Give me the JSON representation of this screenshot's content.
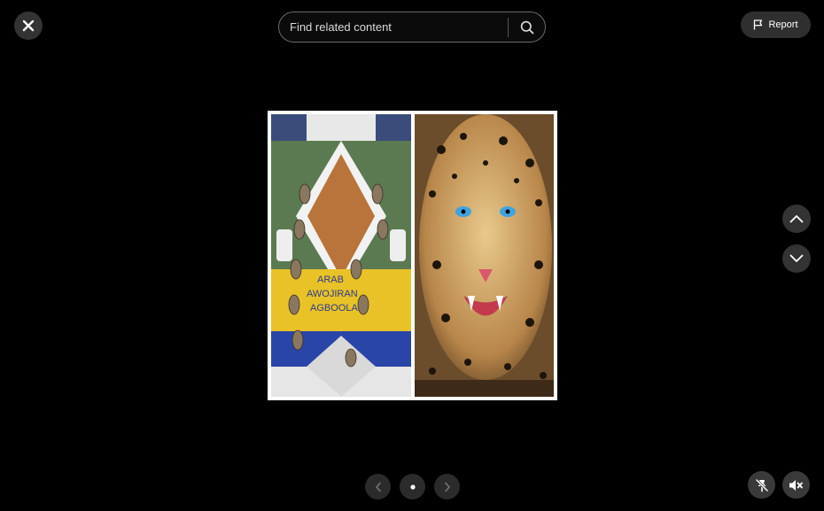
{
  "search": {
    "placeholder": "Find related content"
  },
  "report": {
    "label": "Report"
  },
  "media": {
    "left_panel_text": [
      "ARAB",
      "AWOJIRAN",
      "AGBOOLA"
    ]
  },
  "pager": {
    "total": 1,
    "current": 1
  },
  "icons": {
    "close": "close-icon",
    "search": "search-icon",
    "flag": "flag-icon",
    "up": "chevron-up-icon",
    "down": "chevron-down-icon",
    "prev": "chevron-left-icon",
    "next": "chevron-right-icon",
    "unpin": "unpin-icon",
    "mute": "volume-muted-icon"
  },
  "colors": {
    "background": "#000000",
    "button": "#333333",
    "frame": "#ffffff"
  }
}
